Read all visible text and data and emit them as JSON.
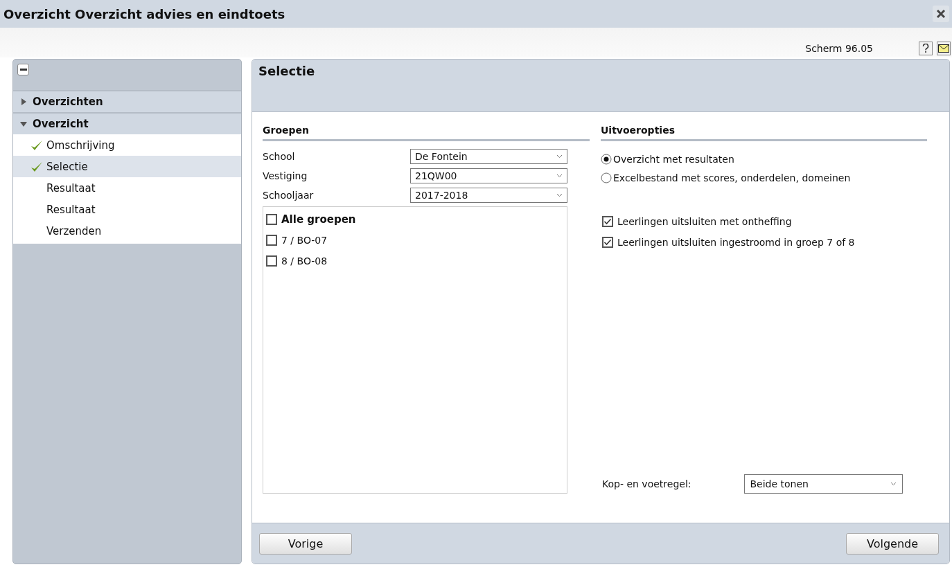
{
  "window": {
    "title": "Overzicht Overzicht advies en eindtoets"
  },
  "screen_label": "Scherm 96.05",
  "sidebar": {
    "collapsed": false,
    "groups": [
      {
        "label": "Overzichten",
        "expanded": false
      },
      {
        "label": "Overzicht",
        "expanded": true,
        "items": [
          {
            "label": "Omschrijving",
            "done": true,
            "selected": false
          },
          {
            "label": "Selectie",
            "done": true,
            "selected": true
          },
          {
            "label": "Resultaat",
            "done": false,
            "selected": false
          },
          {
            "label": "Resultaat",
            "done": false,
            "selected": false
          },
          {
            "label": "Verzenden",
            "done": false,
            "selected": false
          }
        ]
      }
    ]
  },
  "panel": {
    "title": "Selectie",
    "groepen": {
      "title": "Groepen",
      "fields": [
        {
          "label": "School",
          "value": "De Fontein"
        },
        {
          "label": "Vestiging",
          "value": "21QW00"
        },
        {
          "label": "Schooljaar",
          "value": "2017-2018"
        }
      ],
      "groups": [
        {
          "kind": "all",
          "label": "Alle groepen",
          "checked": false
        },
        {
          "kind": "group",
          "label": "7 / BO-07",
          "checked": false
        },
        {
          "kind": "group",
          "label": "8 / BO-08",
          "checked": false
        }
      ]
    },
    "uitvoeropties": {
      "title": "Uitvoeropties",
      "radios": [
        {
          "label": "Overzicht met resultaten",
          "selected": true
        },
        {
          "label": "Excelbestand met scores, onderdelen, domeinen",
          "selected": false
        }
      ],
      "checkboxes": [
        {
          "label": "Leerlingen uitsluiten met ontheffing",
          "checked": true
        },
        {
          "label": "Leerlingen uitsluiten ingestroomd in groep 7 of 8",
          "checked": true
        }
      ],
      "header_footer": {
        "label": "Kop- en voetregel:",
        "value": "Beide tonen"
      }
    }
  },
  "buttons": {
    "previous": "Vorige",
    "next": "Volgende"
  }
}
